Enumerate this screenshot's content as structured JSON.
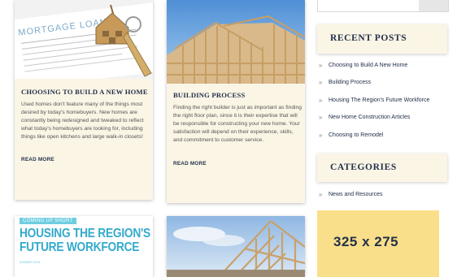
{
  "posts": [
    {
      "title": "CHOOSING TO BUILD A NEW HOME",
      "excerpt": "Used homes don't feature many of the things most desired by today's homebuyers. New homes are constantly being redesigned and tweaked to reflect what today's homebuyers are looking for, including things like open kitchens and large walk-in closets!",
      "read_more": "READ MORE",
      "image_text": "MORTGAGE LOAN"
    },
    {
      "title": "BUILDING PROCESS",
      "excerpt": "Finding the right builder is just as important as finding the right floor plan, since it is their expertise that will be responsible for constructing your new home. Your satisfaction will depend on their experience, skills, and commitment to customer service.",
      "read_more": "READ MORE"
    },
    {
      "tag": "COMING UP SHORT",
      "headline_line1": "HOUSING THE REGION'S",
      "headline_line2": "FUTURE WORKFORCE",
      "small_text": "SUMMER 2018"
    }
  ],
  "sidebar": {
    "recent_title": "RECENT POSTS",
    "recent_posts": [
      "Choosing to Build A New Home",
      "Building Process",
      "Housing The Region's Future Workforce",
      "New Home Construction Articles",
      "Choosing to Remodel"
    ],
    "categories_title": "CATEGORIES",
    "categories": [
      "News and Resources"
    ],
    "chevron": "»",
    "ad_label": "325 x 275"
  },
  "colors": {
    "card_bg": "#fbf5e6",
    "heading": "#22314a",
    "accent_blue": "#34aacb",
    "ad_yellow": "#fadf8a"
  }
}
